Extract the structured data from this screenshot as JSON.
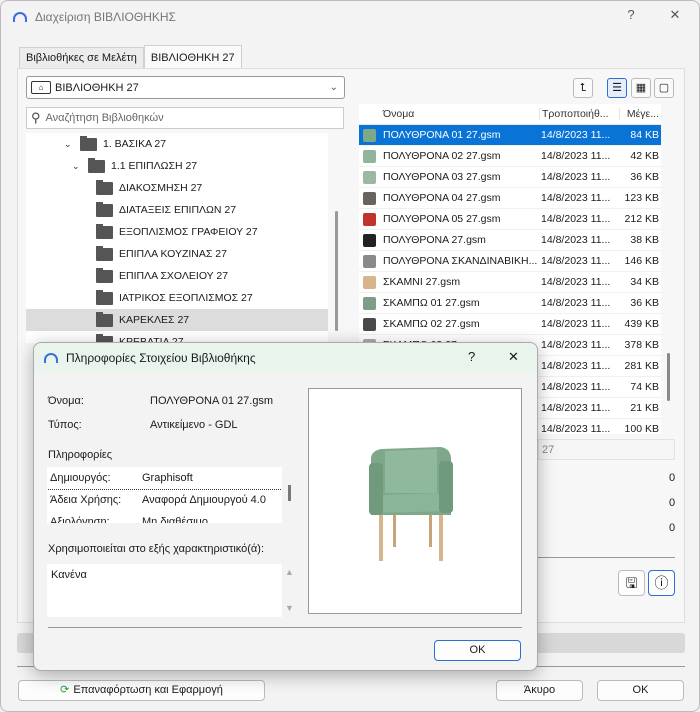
{
  "window": {
    "title": "Διαχείριση ΒΙΒΛΙΟΘΗΚΗΣ",
    "help": "?",
    "close": "✕"
  },
  "tabs": [
    {
      "label": "Βιβλιοθήκες σε Μελέτη"
    },
    {
      "label": "ΒΙΒΛΙΟΘΗΚΗ 27"
    }
  ],
  "library_select": {
    "value": "ΒΙΒΛΙΟΘΗΚΗ 27"
  },
  "search": {
    "placeholder": "Αναζήτηση Βιβλιοθηκών"
  },
  "tree": [
    {
      "label": "1. ΒΑΣΙΚΑ 27",
      "level": 1,
      "expanded": true
    },
    {
      "label": "1.1 ΕΠΙΠΛΩΣΗ 27",
      "level": 2,
      "expanded": true
    },
    {
      "label": "ΔΙΑΚΟΣΜΗΣΗ 27",
      "level": 3
    },
    {
      "label": "ΔΙΑΤΑΞΕΙΣ ΕΠΙΠΛΩΝ 27",
      "level": 3
    },
    {
      "label": "ΕΞΟΠΛΙΣΜΟΣ ΓΡΑΦΕΙΟΥ 27",
      "level": 3
    },
    {
      "label": "ΕΠΙΠΛΑ ΚΟΥΖΙΝΑΣ 27",
      "level": 3
    },
    {
      "label": "ΕΠΙΠΛΑ ΣΧΟΛΕΙΟΥ 27",
      "level": 3
    },
    {
      "label": "ΙΑΤΡΙΚΟΣ ΕΞΟΠΛΙΣΜΟΣ 27",
      "level": 3
    },
    {
      "label": "ΚΑΡΕΚΛΕΣ 27",
      "level": 3,
      "selected": true
    },
    {
      "label": "ΚΡΕΒΑΤΙΑ 27",
      "level": 3
    }
  ],
  "list": {
    "columns": [
      "Όνομα",
      "Τροποποιήθ...",
      "Μέγε..."
    ],
    "rows": [
      {
        "name": "ΠΟΛΥΘΡΟΝΑ 01 27.gsm",
        "date": "14/8/2023 11...",
        "size": "84 KB",
        "color": "#7fa88a",
        "selected": true
      },
      {
        "name": "ΠΟΛΥΘΡΟΝΑ 02 27.gsm",
        "date": "14/8/2023 11...",
        "size": "42 KB",
        "color": "#8fb59a"
      },
      {
        "name": "ΠΟΛΥΘΡΟΝΑ 03 27.gsm",
        "date": "14/8/2023 11...",
        "size": "36 KB",
        "color": "#9cb8a4"
      },
      {
        "name": "ΠΟΛΥΘΡΟΝΑ 04 27.gsm",
        "date": "14/8/2023 11...",
        "size": "123 KB",
        "color": "#6a625c"
      },
      {
        "name": "ΠΟΛΥΘΡΟΝΑ 05 27.gsm",
        "date": "14/8/2023 11...",
        "size": "212 KB",
        "color": "#c0352b"
      },
      {
        "name": "ΠΟΛΥΘΡΟΝΑ 27.gsm",
        "date": "14/8/2023 11...",
        "size": "38 KB",
        "color": "#222222"
      },
      {
        "name": "ΠΟΛΥΘΡΟΝΑ ΣΚΑΝΔΙΝΑΒΙΚΗ...",
        "date": "14/8/2023 11...",
        "size": "146 KB",
        "color": "#8a8a8a"
      },
      {
        "name": "ΣΚΑΜΝΙ 27.gsm",
        "date": "14/8/2023 11...",
        "size": "34 KB",
        "color": "#d8b48a"
      },
      {
        "name": "ΣΚΑΜΠΩ 01 27.gsm",
        "date": "14/8/2023 11...",
        "size": "36 KB",
        "color": "#7f9c88"
      },
      {
        "name": "ΣΚΑΜΠΩ 02 27.gsm",
        "date": "14/8/2023 11...",
        "size": "439 KB",
        "color": "#4a4a4a"
      },
      {
        "name": "ΣΚΑΜΠΩ 03 27.gsm",
        "date": "14/8/2023 11...",
        "size": "378 KB",
        "color": "#aaaaaa"
      },
      {
        "name": "",
        "date": "14/8/2023 11...",
        "size": "281 KB",
        "color": "#cccccc"
      },
      {
        "name": "",
        "date": "14/8/2023 11...",
        "size": "74 KB",
        "color": "#cccccc"
      },
      {
        "name": "",
        "date": "14/8/2023 11...",
        "size": "21 KB",
        "color": "#cccccc"
      },
      {
        "name": "",
        "date": "14/8/2023 11...",
        "size": "100 KB",
        "color": "#cccccc"
      }
    ]
  },
  "right_details": {
    "path_field": "27",
    "counts": [
      "0",
      "0",
      "0"
    ]
  },
  "bottom": {
    "reload_label": "Επαναφόρτωση και Εφαρμογή",
    "cancel_label": "Άκυρο",
    "ok_label": "OK"
  },
  "dialog": {
    "title": "Πληροφορίες Στοιχείου Βιβλιοθήκης",
    "help": "?",
    "close": "✕",
    "name_label": "Όνομα:",
    "name_value": "ΠΟΛΥΘΡΟΝΑ 01 27.gsm",
    "type_label": "Τύπος:",
    "type_value": "Αντικείμενο - GDL",
    "info_heading": "Πληροφορίες",
    "info_rows": [
      {
        "key": "Δημιουργός:",
        "value": "Graphisoft"
      },
      {
        "key": "Άδεια Χρήσης:",
        "value": "Αναφορά Δημιουργού 4.0"
      },
      {
        "key": "Αξιολόγηση:",
        "value": "Μη διαθέσιμο"
      }
    ],
    "used_in_label": "Χρησιμοποιείται στο εξής χαρακτηριστικό(ά):",
    "used_in_value": "Κανένα",
    "ok_label": "OK"
  }
}
